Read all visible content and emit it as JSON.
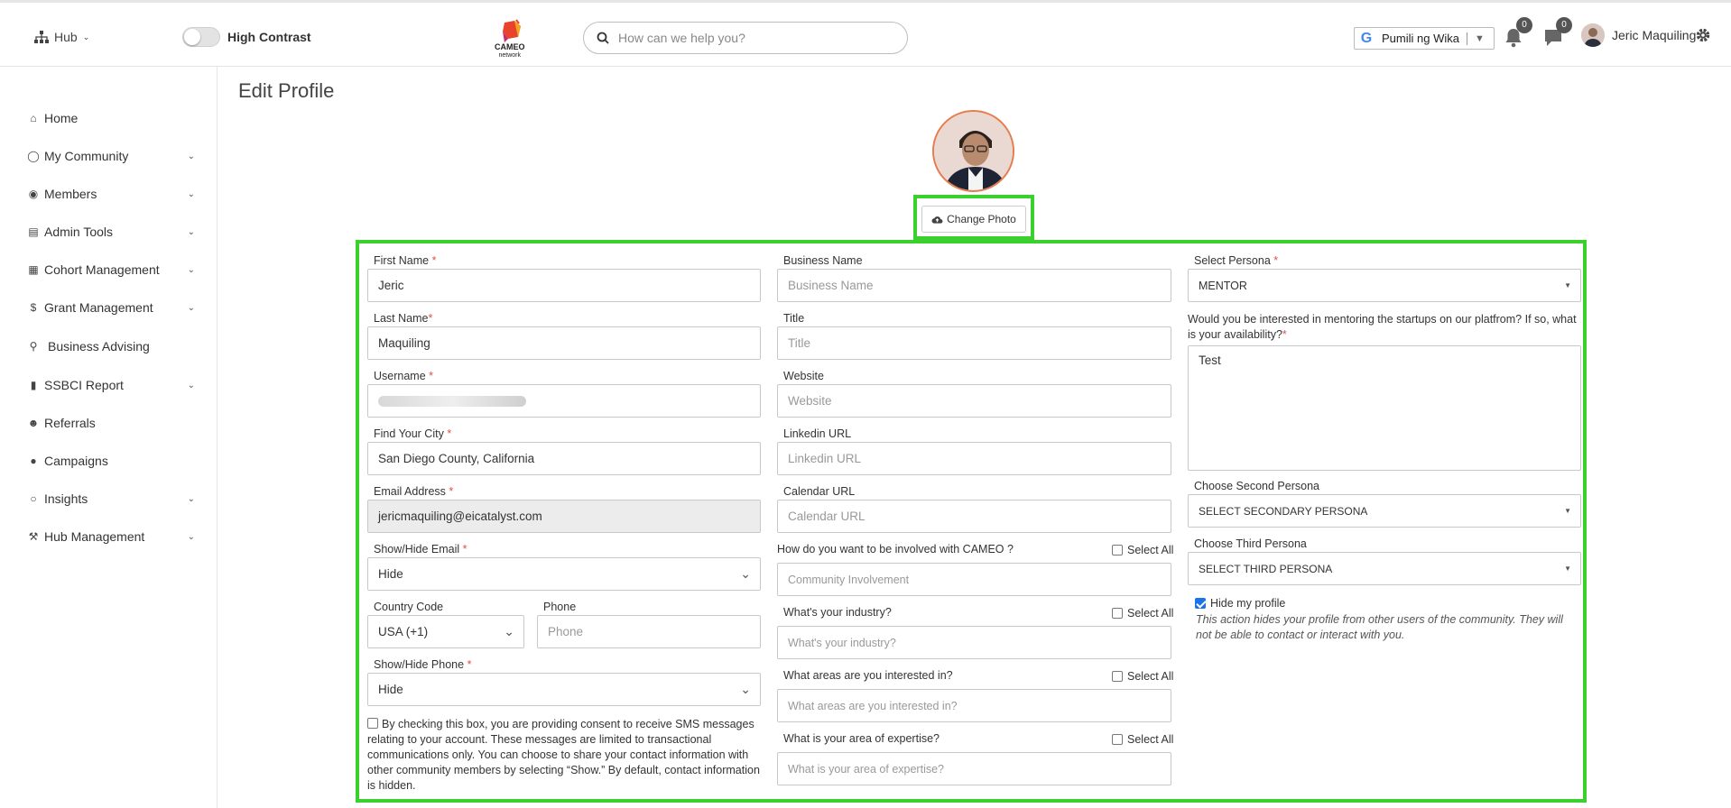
{
  "header": {
    "hub_label": "Hub",
    "contrast_label": "High Contrast",
    "logo_text": "CAMEO",
    "logo_subtext": "network",
    "search_placeholder": "How can we help you?",
    "language_label": "Pumili ng Wika",
    "notifications_count": "0",
    "messages_count": "0",
    "user_name": "Jeric Maquiling"
  },
  "sidebar": {
    "items": [
      {
        "label": "Home",
        "icon": "home-icon",
        "has_chevron": false
      },
      {
        "label": "My Community",
        "icon": "community-icon",
        "has_chevron": true
      },
      {
        "label": "Members",
        "icon": "user-circle-icon",
        "has_chevron": true
      },
      {
        "label": "Admin Tools",
        "icon": "admin-tools-icon",
        "has_chevron": true
      },
      {
        "label": "Cohort Management",
        "icon": "cohort-icon",
        "has_chevron": true
      },
      {
        "label": "Grant Management",
        "icon": "dollar-icon",
        "has_chevron": true
      },
      {
        "label": "Business Advising",
        "icon": "key-icon",
        "has_chevron": false
      },
      {
        "label": "SSBCI Report",
        "icon": "file-icon",
        "has_chevron": true
      },
      {
        "label": "Referrals",
        "icon": "user-plus-icon",
        "has_chevron": false
      },
      {
        "label": "Campaigns",
        "icon": "comment-icon",
        "has_chevron": false
      },
      {
        "label": "Insights",
        "icon": "lightbulb-icon",
        "has_chevron": true
      },
      {
        "label": "Hub Management",
        "icon": "wrench-icon",
        "has_chevron": true
      }
    ]
  },
  "page": {
    "title": "Edit Profile",
    "change_photo_label": "Change Photo"
  },
  "form": {
    "first_name": {
      "label": "First Name",
      "value": "Jeric"
    },
    "last_name": {
      "label": "Last Name",
      "value": "Maquiling"
    },
    "username": {
      "label": "Username",
      "value": ""
    },
    "city": {
      "label": "Find Your City",
      "value": "San Diego County, California"
    },
    "email": {
      "label": "Email Address",
      "value": "jericmaquiling@eicatalyst.com"
    },
    "show_email": {
      "label": "Show/Hide Email",
      "value": "Hide"
    },
    "country_code": {
      "label": "Country Code",
      "value": "USA (+1)"
    },
    "phone": {
      "label": "Phone",
      "placeholder": "Phone"
    },
    "show_phone": {
      "label": "Show/Hide Phone",
      "value": "Hide"
    },
    "consent_text": "By checking this box, you are providing consent to receive SMS messages relating to your account. These messages are limited to transactional communications only. You can choose to share your contact information with other community members by selecting “Show.” By default, contact information is hidden.",
    "business_name": {
      "label": "Business Name",
      "placeholder": "Business Name"
    },
    "title_field": {
      "label": "Title",
      "placeholder": "Title"
    },
    "website": {
      "label": "Website",
      "placeholder": "Website"
    },
    "linkedin": {
      "label": "Linkedin URL",
      "placeholder": "Linkedin URL"
    },
    "calendar": {
      "label": "Calendar URL",
      "placeholder": "Calendar URL"
    },
    "involvement": {
      "label": "How do you want to be involved with CAMEO ?",
      "placeholder": "Community Involvement"
    },
    "industry": {
      "label": "What's your industry?",
      "placeholder": "What's your industry?"
    },
    "interests": {
      "label": "What areas are you interested in?",
      "placeholder": "What areas are you interested in?"
    },
    "expertise": {
      "label": "What is your area of expertise?",
      "placeholder": "What is your area of expertise?"
    },
    "select_all_label": "Select All",
    "persona": {
      "label": "Select Persona",
      "value": "MENTOR"
    },
    "mentoring_question": "Would you be interested in mentoring the startups on our platfrom? If so, what is your availability?",
    "mentoring_answer": "Test",
    "second_persona": {
      "label": "Choose Second Persona",
      "value": "SELECT SECONDARY PERSONA"
    },
    "third_persona": {
      "label": "Choose Third Persona",
      "value": "SELECT THIRD PERSONA"
    },
    "hide_profile": {
      "label": "Hide my profile",
      "checked": true
    },
    "hide_profile_note": "This action hides your profile from other users of the community. They will not be able to contact or interact with you."
  }
}
